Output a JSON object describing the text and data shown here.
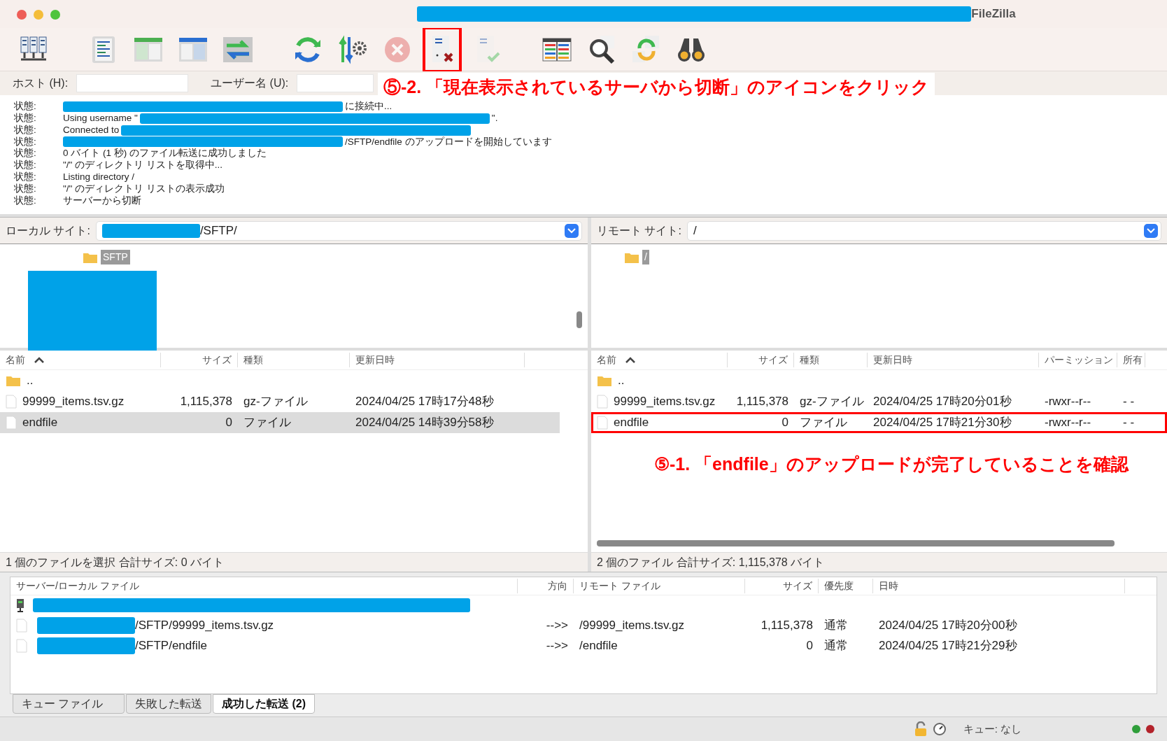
{
  "window": {
    "title": "FileZilla",
    "title_redacted": true
  },
  "toolbar": [
    [
      {
        "kind": "site-manager",
        "disabled": false,
        "highlighted": false
      }
    ],
    [
      {
        "kind": "log",
        "disabled": false,
        "highlighted": false
      },
      {
        "kind": "local-tree",
        "disabled": false,
        "highlighted": false
      },
      {
        "kind": "remote-tree",
        "disabled": false,
        "highlighted": false
      },
      {
        "kind": "queue",
        "disabled": false,
        "highlighted": false
      }
    ],
    [
      {
        "kind": "refresh",
        "disabled": false,
        "highlighted": false
      },
      {
        "kind": "process-queue",
        "disabled": false,
        "highlighted": false
      },
      {
        "kind": "cancel",
        "disabled": true,
        "highlighted": false
      },
      {
        "kind": "disconnect",
        "disabled": false,
        "highlighted": true
      },
      {
        "kind": "reconnect",
        "disabled": true,
        "highlighted": false
      }
    ],
    [
      {
        "kind": "compare",
        "disabled": false,
        "highlighted": false
      },
      {
        "kind": "filter",
        "disabled": false,
        "highlighted": false
      },
      {
        "kind": "sync",
        "disabled": false,
        "highlighted": false
      },
      {
        "kind": "search",
        "disabled": false,
        "highlighted": false
      }
    ]
  ],
  "quickconnect": {
    "fields": [
      {
        "label": "ホスト (H):"
      },
      {
        "label": "ユーザー名 (U):"
      }
    ]
  },
  "log": [
    {
      "label": "状態:",
      "parts": [
        {
          "kind": "redacted"
        },
        {
          "kind": "text",
          "text": "に接続中..."
        }
      ]
    },
    {
      "label": "状態:",
      "parts": [
        {
          "kind": "text",
          "text": "Using username \""
        },
        {
          "kind": "redacted"
        },
        {
          "kind": "text",
          "text": "\"."
        }
      ]
    },
    {
      "label": "状態:",
      "parts": [
        {
          "kind": "text",
          "text": "Connected to"
        },
        {
          "kind": "redacted"
        }
      ]
    },
    {
      "label": "状態:",
      "parts": [
        {
          "kind": "redacted"
        },
        {
          "kind": "text",
          "text": "/SFTP/endfile のアップロードを開始しています"
        }
      ]
    },
    {
      "label": "状態:",
      "parts": [
        {
          "kind": "text",
          "text": "0 バイト (1 秒) のファイル転送に成功しました"
        }
      ]
    },
    {
      "label": "状態:",
      "parts": [
        {
          "kind": "text",
          "text": "\"/\" のディレクトリ リストを取得中..."
        }
      ]
    },
    {
      "label": "状態:",
      "parts": [
        {
          "kind": "text",
          "text": "Listing directory /"
        }
      ]
    },
    {
      "label": "状態:",
      "parts": [
        {
          "kind": "text",
          "text": "\"/\" のディレクトリ リストの表示成功"
        }
      ]
    },
    {
      "label": "状態:",
      "parts": [
        {
          "kind": "text",
          "text": "サーバーから切断"
        }
      ]
    }
  ],
  "local": {
    "site_label": "ローカル サイト:",
    "path": "/SFTP/",
    "path_redacted": true,
    "tree": [
      {
        "name": "SFTP",
        "selected": true,
        "redacted_below": true
      }
    ],
    "columns": [
      "名前",
      "サイズ",
      "種類",
      "更新日時"
    ],
    "rows": [
      {
        "kind": "folder",
        "name": "..",
        "selected": false,
        "highlighted": false
      },
      {
        "kind": "file",
        "name": "99999_items.tsv.gz",
        "size": "1,115,378",
        "type": "gz-ファイル",
        "modified": "2024/04/25 17時17分48秒",
        "selected": false,
        "highlighted": false
      },
      {
        "kind": "file",
        "name": "endfile",
        "size": "0",
        "type": "ファイル",
        "modified": "2024/04/25 14時39分58秒",
        "selected": true,
        "highlighted": false
      }
    ],
    "status": "1 個のファイルを選択 合計サイズ: 0 バイト"
  },
  "remote": {
    "site_label": "リモート サイト:",
    "path": "/",
    "path_redacted": false,
    "tree": [
      {
        "name": "/",
        "selected": true,
        "redacted_below": false
      }
    ],
    "columns": [
      "名前",
      "サイズ",
      "種類",
      "更新日時",
      "パーミッション",
      "所有"
    ],
    "rows": [
      {
        "kind": "folder",
        "name": "..",
        "selected": false,
        "highlighted": false
      },
      {
        "kind": "file",
        "name": "99999_items.tsv.gz",
        "size": "1,115,378",
        "type": "gz-ファイル",
        "modified": "2024/04/25 17時20分01秒",
        "permissions": "-rwxr--r--",
        "owner": "- -",
        "selected": false,
        "highlighted": false
      },
      {
        "kind": "file",
        "name": "endfile",
        "size": "0",
        "type": "ファイル",
        "modified": "2024/04/25 17時21分30秒",
        "permissions": "-rwxr--r--",
        "owner": "- -",
        "selected": false,
        "highlighted": true
      }
    ],
    "status": "2 個のファイル 合計サイズ: 1,115,378 バイト"
  },
  "queue": {
    "columns": [
      "サーバー/ローカル ファイル",
      "方向",
      "リモート ファイル",
      "サイズ",
      "優先度",
      "日時"
    ],
    "server": {
      "redacted": true
    },
    "rows": [
      {
        "local": "/SFTP/99999_items.tsv.gz",
        "direction": "-->>",
        "remote": "/99999_items.tsv.gz",
        "size": "1,115,378",
        "priority": "通常",
        "time": "2024/04/25 17時20分00秒"
      },
      {
        "local": "/SFTP/endfile",
        "direction": "-->>",
        "remote": "/endfile",
        "size": "0",
        "priority": "通常",
        "time": "2024/04/25 17時21分29秒"
      }
    ]
  },
  "queue_tabs": [
    {
      "label": "キュー ファイル",
      "selected": false
    },
    {
      "label": "失敗した転送",
      "selected": false
    },
    {
      "label": "成功した転送 (2)",
      "selected": true
    }
  ],
  "status_bar": {
    "queue": "キュー: なし",
    "lights": [
      {
        "color": "#2f9e3a"
      },
      {
        "color": "#b3222a"
      }
    ]
  },
  "annotations": [
    {
      "text": "⑤-2. 「現在表示されているサーバから切断」のアイコンをクリック"
    },
    {
      "text": "⑤-1. 「endfile」のアップロードが完了していることを確認"
    }
  ]
}
